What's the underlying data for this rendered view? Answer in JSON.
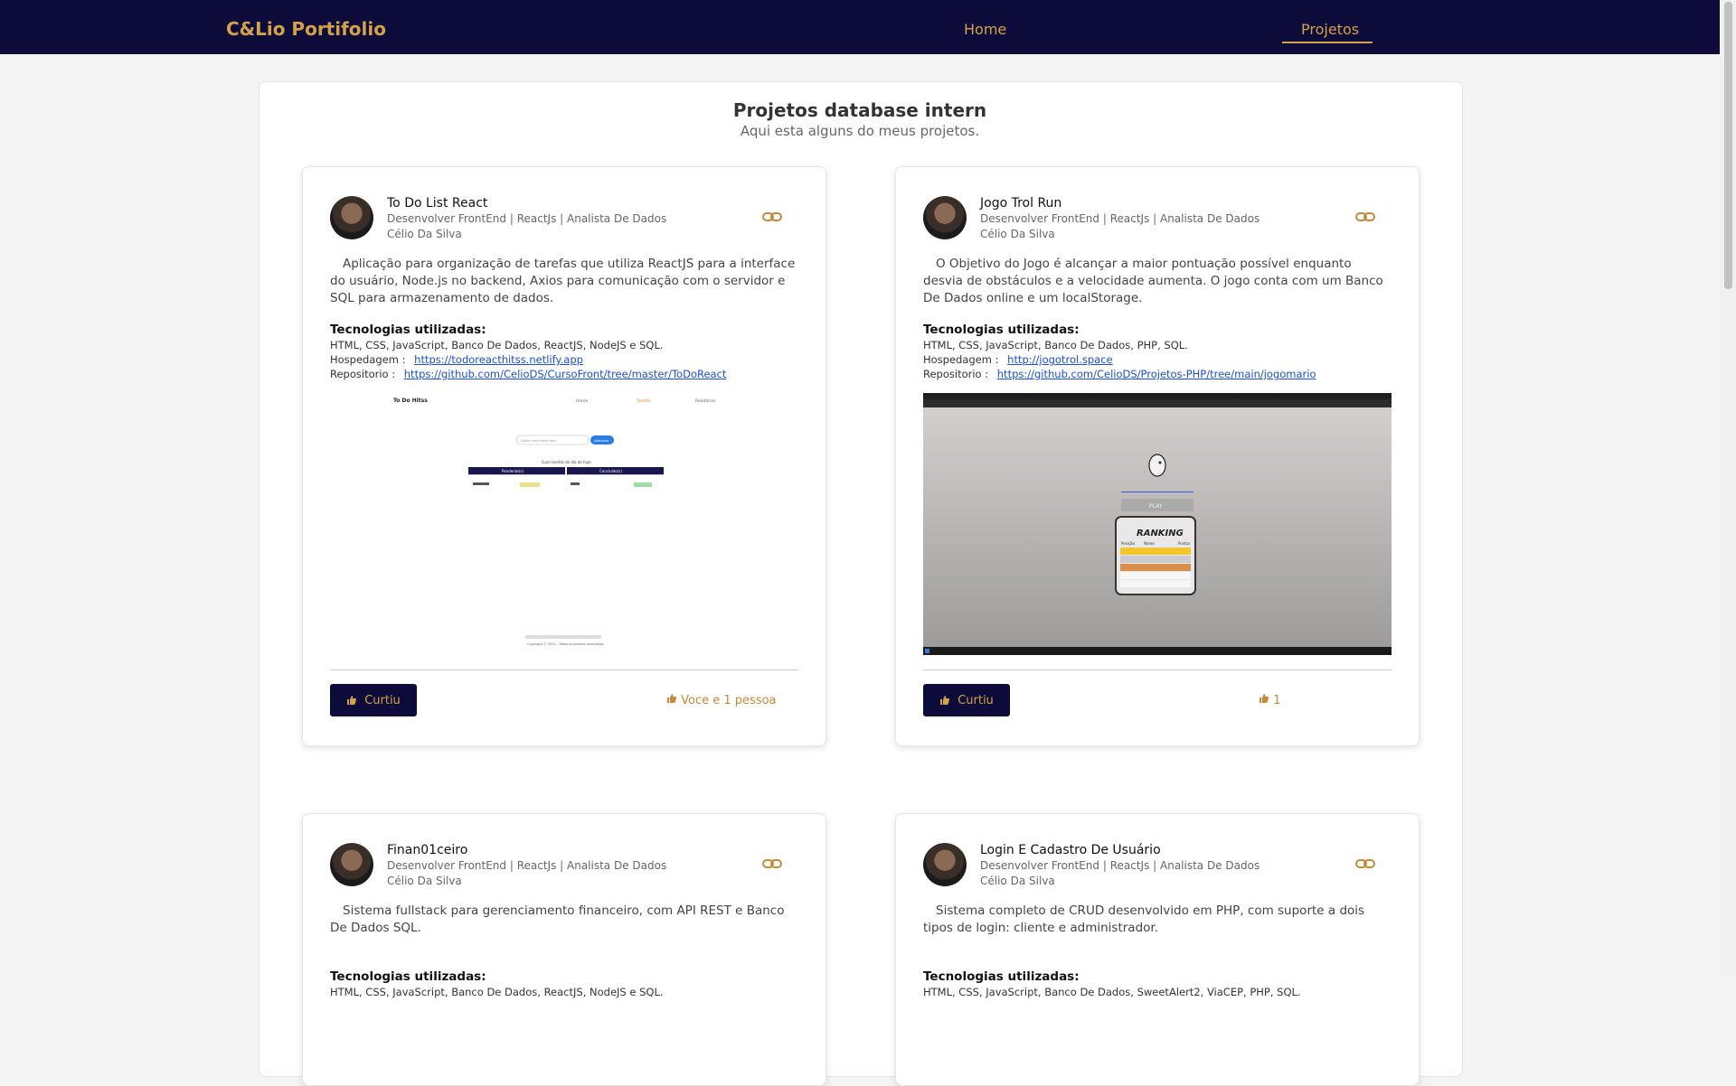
{
  "navbar": {
    "brand": "C&Lio Portifolio",
    "links": [
      {
        "label": "Home"
      },
      {
        "label": "Projetos",
        "active": true
      }
    ],
    "accent": "#d4a04a",
    "background": "#0c0b3a"
  },
  "section": {
    "title": "Projetos database intern",
    "subtitle": "Aqui esta alguns do meus projetos."
  },
  "projects": [
    {
      "title": "To Do List React",
      "role": "Desenvolver FrontEnd | ReactJs | Analista De Dados",
      "author": "Célio Da Silva",
      "description": "Aplicação para organização de tarefas que utiliza ReactJS para a interface do usuário, Node.js no backend, Axios para comunicação com o servidor e SQL para armazenamento de dados.",
      "tech_title": "Tecnologias utilizadas:",
      "tech_list": "HTML, CSS, JavaScript, Banco De Dados, ReactJS, NodeJS e SQL.",
      "host_label": "Hospedagem :",
      "host_url": "https://todoreacthitss.netlify.app",
      "repo_label": "Repositorio :",
      "repo_url": "https://github.com/CelioDS/CursoFront/tree/master/ToDoReact",
      "preview": {
        "brand": "To Do Hitss",
        "nav": [
          "Home",
          "Tarefas",
          "Relatórios"
        ],
        "input_placeholder": "Digite uma tarefa aqui",
        "button": "Adicionar",
        "heading": "Suas tarefas do dia de hoje",
        "col1": "Pendente(s)",
        "col2": "Concluído(s)",
        "footer": "Copyright © 2024 - Todos os direitos reservados"
      },
      "like_label": "Curtiu",
      "likes_text": "Voce e 1 pessoa"
    },
    {
      "title": "Jogo Trol Run",
      "role": "Desenvolver FrontEnd | ReactJs | Analista De Dados",
      "author": "Célio Da Silva",
      "description": "O Objetivo do Jogo é alcançar a maior pontuação possível enquanto desvia de obstáculos e a velocidade aumenta. O jogo conta com um Banco De Dados online e um localStorage.",
      "tech_title": "Tecnologias utilizadas:",
      "tech_list": "HTML, CSS, JavaScript, Banco De Dados, PHP, SQL.",
      "host_label": "Hospedagem :",
      "host_url": "http://jogotrol.space",
      "repo_label": "Repositorio :",
      "repo_url": "https://github.com/CelioDS/Projetos-PHP/tree/main/jogomario",
      "preview": {
        "play": "PLAY",
        "ranking": "RANKING",
        "headers": [
          "Posição",
          "Nome",
          "Pontos"
        ]
      },
      "like_label": "Curtiu",
      "likes_text": "1"
    },
    {
      "title": "Finan01ceiro",
      "role": "Desenvolver FrontEnd | ReactJs | Analista De Dados",
      "author": "Célio Da Silva",
      "description": "Sistema fullstack para gerenciamento financeiro, com API REST e Banco De Dados SQL.",
      "tech_title": "Tecnologias utilizadas:",
      "tech_list": "HTML, CSS, JavaScript, Banco De Dados, ReactJS, NodeJS e SQL."
    },
    {
      "title": "Login E Cadastro De Usuário",
      "role": "Desenvolver FrontEnd | ReactJs | Analista De Dados",
      "author": "Célio Da Silva",
      "description": "Sistema completo de CRUD desenvolvido em PHP, com suporte a dois tipos de login: cliente e administrador.",
      "tech_title": "Tecnologias utilizadas:",
      "tech_list": "HTML, CSS, JavaScript, Banco De Dados, SweetAlert2, ViaCEP, PHP, SQL."
    }
  ]
}
